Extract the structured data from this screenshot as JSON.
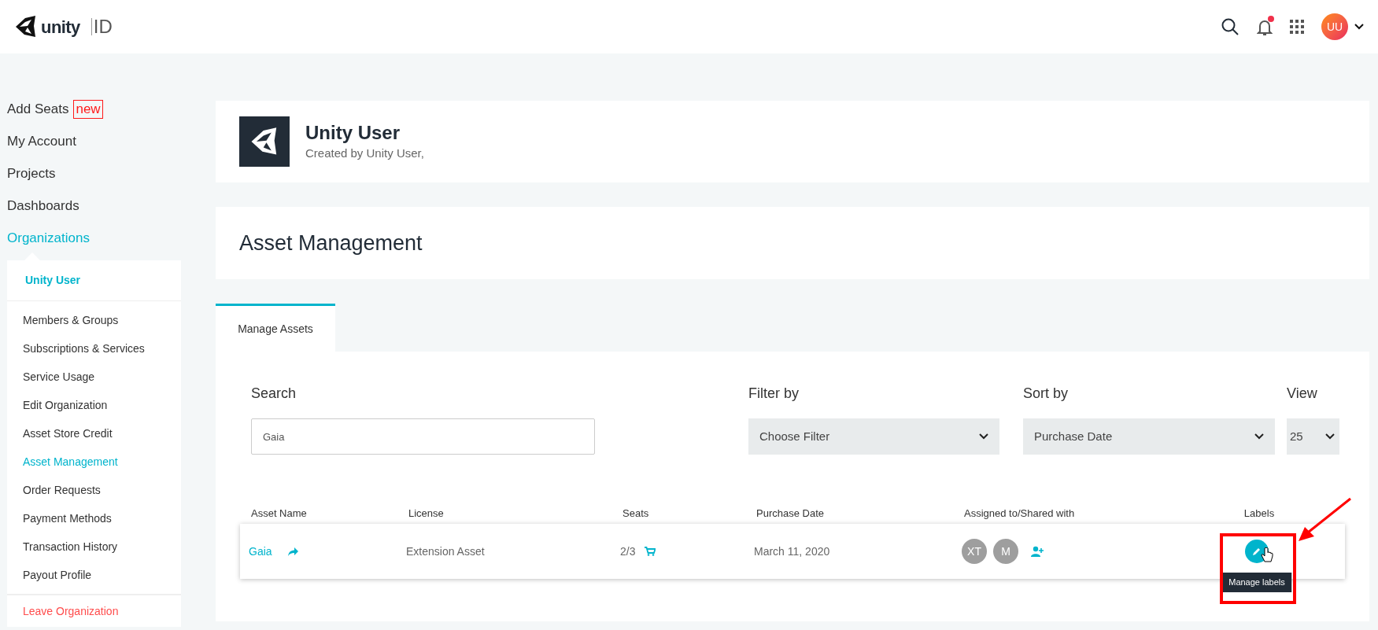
{
  "header": {
    "logo_text": "unity",
    "logo_suffix": "ID",
    "avatar_initials": "UU",
    "has_notification": true
  },
  "sidebar": {
    "items": [
      {
        "label": "Add Seats",
        "badge": "new",
        "selected": false
      },
      {
        "label": "My Account",
        "selected": false
      },
      {
        "label": "Projects",
        "selected": false
      },
      {
        "label": "Dashboards",
        "selected": false
      },
      {
        "label": "Organizations",
        "selected": true
      }
    ],
    "organization": {
      "name": "Unity User",
      "items": [
        {
          "label": "Members & Groups",
          "selected": false
        },
        {
          "label": "Subscriptions & Services",
          "selected": false
        },
        {
          "label": "Service Usage",
          "selected": false
        },
        {
          "label": "Edit Organization",
          "selected": false
        },
        {
          "label": "Asset Store Credit",
          "selected": false
        },
        {
          "label": "Asset Management",
          "selected": true
        },
        {
          "label": "Order Requests",
          "selected": false
        },
        {
          "label": "Payment Methods",
          "selected": false
        },
        {
          "label": "Transaction History",
          "selected": false
        },
        {
          "label": "Payout Profile",
          "selected": false
        }
      ],
      "leave": "Leave Organization"
    }
  },
  "profile": {
    "name": "Unity User",
    "subtitle": "Created by Unity User,"
  },
  "page_title": "Asset Management",
  "tabs": [
    {
      "label": "Manage Assets",
      "selected": true
    }
  ],
  "filters": {
    "search": {
      "label": "Search",
      "value": "Gaia"
    },
    "filter_by": {
      "label": "Filter by",
      "value": "Choose Filter"
    },
    "sort_by": {
      "label": "Sort by",
      "value": "Purchase Date"
    },
    "view": {
      "label": "View",
      "value": "25"
    }
  },
  "table": {
    "columns": [
      "Asset Name",
      "License",
      "Seats",
      "Purchase Date",
      "Assigned to/Shared with",
      "Labels"
    ],
    "rows": [
      {
        "name": "Gaia",
        "license": "Extension Asset",
        "seats": "2/3",
        "purchase_date": "March 11, 2020",
        "assigned": [
          "XT",
          "M"
        ],
        "tooltip": "Manage labels"
      }
    ]
  }
}
